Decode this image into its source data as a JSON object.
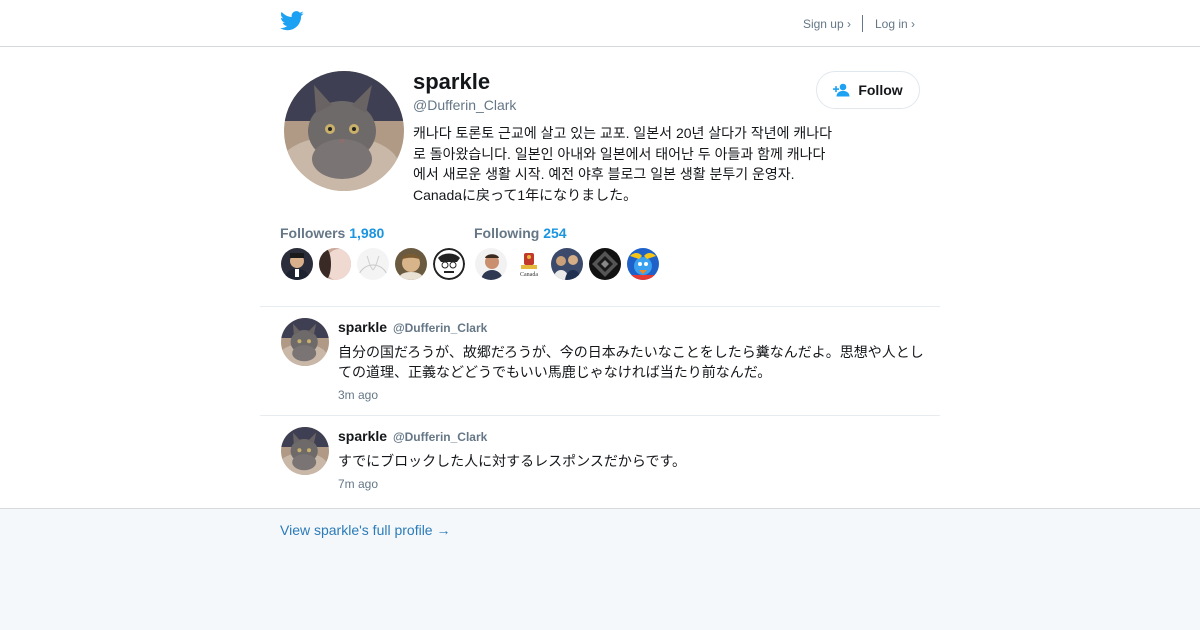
{
  "header": {
    "logo_icon": "twitter-bird-icon",
    "signup_label": "Sign up ›",
    "login_label": "Log in ›"
  },
  "profile": {
    "name": "sparkle",
    "handle": "@Dufferin_Clark",
    "bio": "캐나다 토론토 근교에 살고 있는 교포. 일본서 20년 살다가 작년에 캐나다로 돌아왔습니다. 일본인 아내와 일본에서 태어난 두 아들과 함께 캐나다에서 새로운 생활 시작. 예전 야후 블로그 일본 생활 분투기 운영자. Canadaに戻って1年になりました。",
    "follow_label": "Follow",
    "follow_icon": "add-user-icon"
  },
  "stats": {
    "followers_label": "Followers",
    "followers_count": "1,980",
    "following_label": "Following",
    "following_count": "254"
  },
  "tweets": [
    {
      "name": "sparkle",
      "handle": "@Dufferin_Clark",
      "text": "自分の国だろうが、故郷だろうが、今の日本みたいなことをしたら糞なんだよ。思想や人としての道理、正義などどうでもいい馬鹿じゃなければ当たり前なんだ。",
      "time": "3m ago"
    },
    {
      "name": "sparkle",
      "handle": "@Dufferin_Clark",
      "text": "すでにブロックした人に対するレスポンスだからです。",
      "time": "7m ago"
    }
  ],
  "footer": {
    "full_profile_label": "View sparkle's full profile →"
  },
  "colors": {
    "accent": "#1b95e0",
    "link": "#2b7bb9",
    "muted": "#657786",
    "brand": "#1da1f2"
  }
}
